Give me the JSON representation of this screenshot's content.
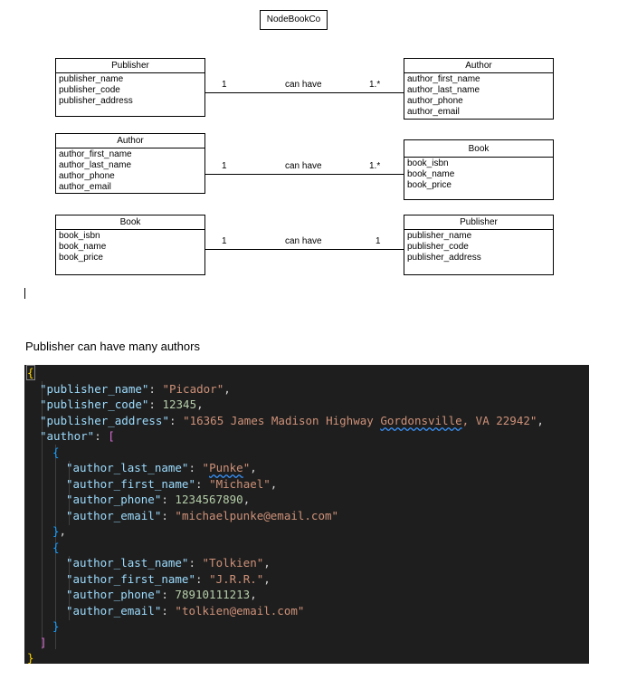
{
  "diagram": {
    "title": "NodeBookCo",
    "entities": {
      "publisher_1": {
        "name": "Publisher",
        "attributes": [
          "publisher_name",
          "publisher_code",
          "publisher_address"
        ]
      },
      "author_1": {
        "name": "Author",
        "attributes": [
          "author_first_name",
          "author_last_name",
          "author_phone",
          "author_email"
        ]
      },
      "author_2": {
        "name": "Author",
        "attributes": [
          "author_first_name",
          "author_last_name",
          "author_phone",
          "author_email"
        ]
      },
      "book_1": {
        "name": "Book",
        "attributes": [
          "book_isbn",
          "book_name",
          "book_price"
        ]
      },
      "book_2": {
        "name": "Book",
        "attributes": [
          "book_isbn",
          "book_name",
          "book_price"
        ]
      },
      "publisher_2": {
        "name": "Publisher",
        "attributes": [
          "publisher_name",
          "publisher_code",
          "publisher_address"
        ]
      }
    },
    "relations": [
      {
        "from": "Publisher",
        "to": "Author",
        "left_cardinality": "1",
        "label": "can have",
        "right_cardinality": "1.*"
      },
      {
        "from": "Author",
        "to": "Book",
        "left_cardinality": "1",
        "label": "can have",
        "right_cardinality": "1.*"
      },
      {
        "from": "Book",
        "to": "Publisher",
        "left_cardinality": "1",
        "label": "can have",
        "right_cardinality": "1"
      }
    ]
  },
  "caption": "Publisher can have many authors",
  "code": {
    "open_brace": "{",
    "close_brace": "}",
    "publisher_name": {
      "key": "\"publisher_name\"",
      "value": "\"Picador\""
    },
    "publisher_code": {
      "key": "\"publisher_code\"",
      "value": "12345"
    },
    "publisher_address": {
      "key": "\"publisher_address\"",
      "value_start": "\"16365 James Madison Highway ",
      "value_squiggle": "Gordonsville",
      "value_end": ", VA 22942\""
    },
    "author": {
      "key": "\"author\"",
      "open_bracket": "[",
      "close_bracket": "]"
    },
    "authors": [
      {
        "last_name": {
          "key": "\"author_last_name\"",
          "value_quote": "\"",
          "value_squiggle": "Punke",
          "value_end": "\""
        },
        "first_name": {
          "key": "\"author_first_name\"",
          "value": "\"Michael\""
        },
        "phone": {
          "key": "\"author_phone\"",
          "value": "1234567890"
        },
        "email": {
          "key": "\"author_email\"",
          "value": "\"michaelpunke@email.com\""
        }
      },
      {
        "last_name": {
          "key": "\"author_last_name\"",
          "value": "\"Tolkien\""
        },
        "first_name": {
          "key": "\"author_first_name\"",
          "value": "\"J.R.R.\""
        },
        "phone": {
          "key": "\"author_phone\"",
          "value": "78910111213"
        },
        "email": {
          "key": "\"author_email\"",
          "value": "\"tolkien@email.com\""
        }
      }
    ]
  }
}
